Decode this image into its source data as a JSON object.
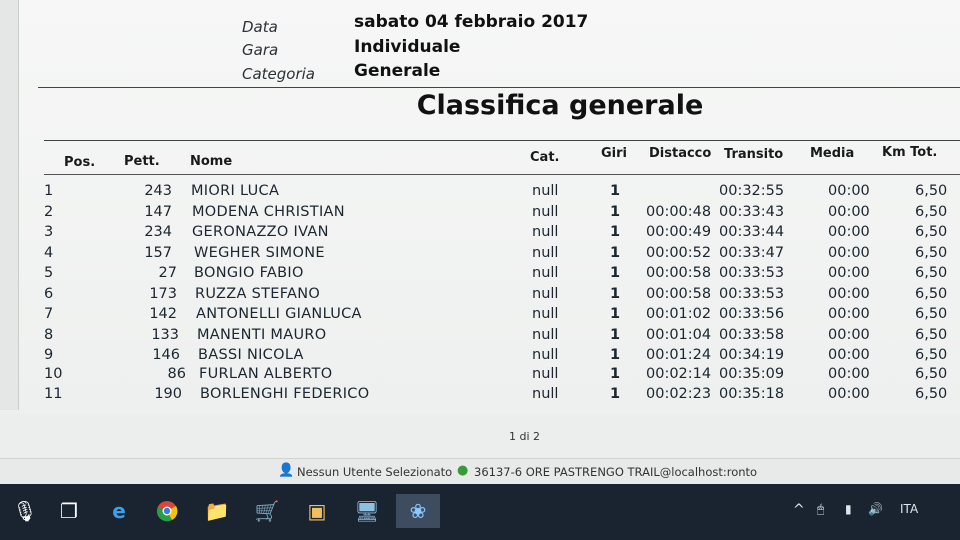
{
  "header": {
    "data_label": "Data",
    "data_value": "sabato 04 febbraio 2017",
    "gara_label": "Gara",
    "gara_value": "Individuale",
    "categoria_label": "Categoria",
    "categoria_value": "Generale"
  },
  "title": "Classifica generale",
  "columns": {
    "pos": "Pos.",
    "pett": "Pett.",
    "nome": "Nome",
    "cat": "Cat.",
    "giri": "Giri",
    "distacco": "Distacco",
    "transito": "Transito",
    "media": "Media",
    "km": "Km Tot."
  },
  "rows": [
    {
      "pos": "1",
      "pett": "243",
      "nome": "MIORI LUCA",
      "cat": "null",
      "giri": "1",
      "distacco": "",
      "transito": "00:32:55",
      "media": "00:00",
      "km": "6,50"
    },
    {
      "pos": "2",
      "pett": "147",
      "nome": "MODENA CHRISTIAN",
      "cat": "null",
      "giri": "1",
      "distacco": "00:00:48",
      "transito": "00:33:43",
      "media": "00:00",
      "km": "6,50"
    },
    {
      "pos": "3",
      "pett": "234",
      "nome": "GERONAZZO IVAN",
      "cat": "null",
      "giri": "1",
      "distacco": "00:00:49",
      "transito": "00:33:44",
      "media": "00:00",
      "km": "6,50"
    },
    {
      "pos": "4",
      "pett": "157",
      "nome": "WEGHER SIMONE",
      "cat": "null",
      "giri": "1",
      "distacco": "00:00:52",
      "transito": "00:33:47",
      "media": "00:00",
      "km": "6,50"
    },
    {
      "pos": "5",
      "pett": "27",
      "nome": "BONGIO FABIO",
      "cat": "null",
      "giri": "1",
      "distacco": "00:00:58",
      "transito": "00:33:53",
      "media": "00:00",
      "km": "6,50"
    },
    {
      "pos": "6",
      "pett": "173",
      "nome": "RUZZA STEFANO",
      "cat": "null",
      "giri": "1",
      "distacco": "00:00:58",
      "transito": "00:33:53",
      "media": "00:00",
      "km": "6,50"
    },
    {
      "pos": "7",
      "pett": "142",
      "nome": "ANTONELLI GIANLUCA",
      "cat": "null",
      "giri": "1",
      "distacco": "00:01:02",
      "transito": "00:33:56",
      "media": "00:00",
      "km": "6,50"
    },
    {
      "pos": "8",
      "pett": "133",
      "nome": "MANENTI MAURO",
      "cat": "null",
      "giri": "1",
      "distacco": "00:01:04",
      "transito": "00:33:58",
      "media": "00:00",
      "km": "6,50"
    },
    {
      "pos": "9",
      "pett": "146",
      "nome": "BASSI NICOLA",
      "cat": "null",
      "giri": "1",
      "distacco": "00:01:24",
      "transito": "00:34:19",
      "media": "00:00",
      "km": "6,50"
    },
    {
      "pos": "10",
      "pett": "86",
      "nome": "FURLAN ALBERTO",
      "cat": "null",
      "giri": "1",
      "distacco": "00:02:14",
      "transito": "00:35:09",
      "media": "00:00",
      "km": "6,50"
    },
    {
      "pos": "11",
      "pett": "190",
      "nome": "BORLENGHI FEDERICO",
      "cat": "null",
      "giri": "1",
      "distacco": "00:02:23",
      "transito": "00:35:18",
      "media": "00:00",
      "km": "6,50"
    }
  ],
  "pager": "1 di 2",
  "status": {
    "user": "Nessun Utente Selezionato",
    "connection": "36137-6 ORE PASTRENGO TRAIL@localhost:ronto"
  },
  "taskbar": {
    "language": "ITA"
  }
}
